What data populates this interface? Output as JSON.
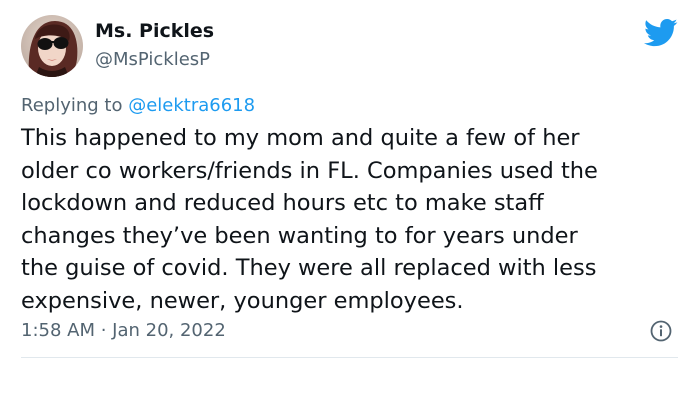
{
  "author": {
    "name": "Ms. Pickles",
    "handle": "@MsPicklesP",
    "avatar": "profile-photo"
  },
  "reply": {
    "prefix": "Replying to",
    "mention": "@elektra6618"
  },
  "body_lines": [
    "This happened to my mom and quite a few of her",
    "older co workers/friends in FL. Companies used the",
    "lockdown and reduced hours etc to make staff",
    "changes they’ve been wanting to for years under",
    "the guise of covid. They were all replaced with less",
    "expensive, newer, younger employees."
  ],
  "meta": {
    "timestamp": "1:58 AM · Jan 20, 2022"
  },
  "icons": {
    "brand": "twitter-bird-icon",
    "info": "info-icon"
  },
  "colors": {
    "brand": "#1d9bf0",
    "text": "#0f1419",
    "secondary": "#536471",
    "divider": "#e1e8ed"
  }
}
